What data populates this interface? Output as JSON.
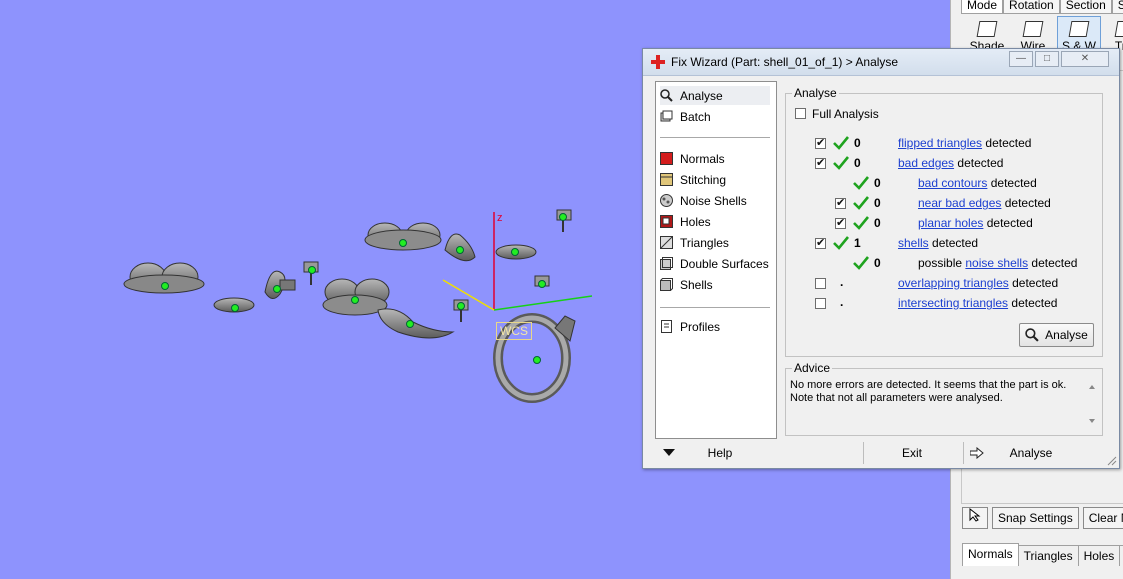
{
  "right_panel": {
    "top_tabs": [
      "Mode",
      "Rotation",
      "Section",
      "Sup"
    ],
    "tools": [
      "Shade",
      "Wire",
      "S & W",
      "Tria"
    ],
    "buttons": [
      "Snap Settings",
      "Clear M"
    ],
    "bottom_tabs": [
      "Normals",
      "Triangles",
      "Holes",
      "Po"
    ]
  },
  "viewport": {
    "background": "#8e93fd",
    "wcs_label": "WCS",
    "axis_z_label": "z"
  },
  "dialog": {
    "title": "Fix Wizard (Part: shell_01_of_1) > Analyse",
    "nav": [
      {
        "label": "Analyse",
        "icon": "magnifier-icon"
      },
      {
        "label": "Batch",
        "icon": "batch-icon"
      },
      {
        "label": "Normals",
        "icon": "normals-icon"
      },
      {
        "label": "Stitching",
        "icon": "stitching-icon"
      },
      {
        "label": "Noise Shells",
        "icon": "noise-shells-icon"
      },
      {
        "label": "Holes",
        "icon": "holes-icon"
      },
      {
        "label": "Triangles",
        "icon": "triangles-icon"
      },
      {
        "label": "Double Surfaces",
        "icon": "double-surfaces-icon"
      },
      {
        "label": "Shells",
        "icon": "shells-icon"
      },
      {
        "label": "Profiles",
        "icon": "profiles-icon"
      }
    ],
    "analyse_group": {
      "label": "Analyse",
      "full_analysis": "Full Analysis",
      "detected": "detected",
      "possible": "possible",
      "rows": [
        {
          "count": "0",
          "link": "flipped triangles",
          "checked": true
        },
        {
          "count": "0",
          "link": "bad edges",
          "checked": true
        },
        {
          "count": "0",
          "link": "bad contours"
        },
        {
          "count": "0",
          "link": "near bad edges",
          "checked": true
        },
        {
          "count": "0",
          "link": "planar holes",
          "checked": true
        },
        {
          "count": "1",
          "link": "shells",
          "checked": true
        },
        {
          "count": "0",
          "link": "noise shells"
        },
        {
          "count": ".",
          "link": "overlapping triangles",
          "checked": false
        },
        {
          "count": ".",
          "link": "intersecting triangles",
          "checked": false
        }
      ],
      "analyse_button": "Analyse"
    },
    "advice": {
      "label": "Advice",
      "text": "No more errors are detected. It seems that the part is ok. Note that not all parameters were analysed."
    },
    "footer": {
      "help": "Help",
      "exit": "Exit",
      "analyse": "Analyse"
    },
    "check_color": "#1fa31f",
    "link_color": "#1c3fd0"
  }
}
